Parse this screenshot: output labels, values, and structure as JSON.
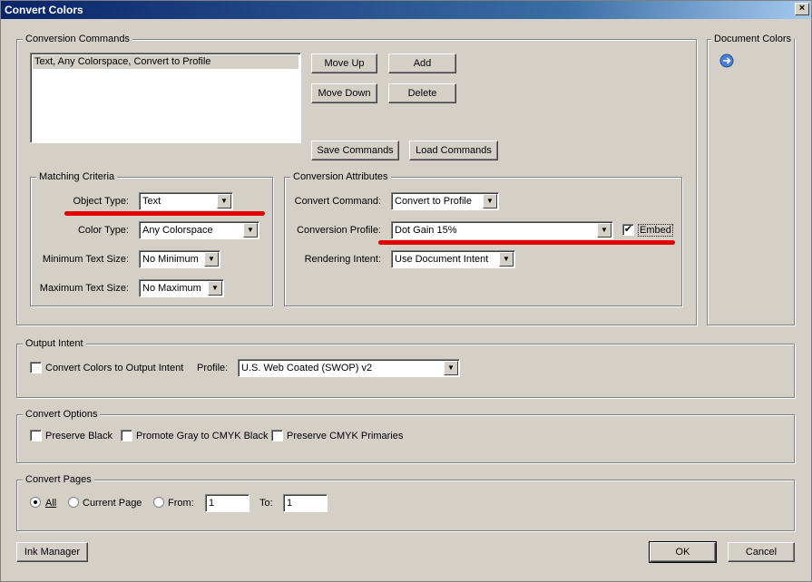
{
  "window": {
    "title": "Convert Colors",
    "close_glyph": "×"
  },
  "conversion_commands": {
    "group_label": "Conversion Commands",
    "list_items": [
      "Text, Any Colorspace, Convert to Profile"
    ],
    "buttons": {
      "move_up": "Move Up",
      "add": "Add",
      "move_down": "Move Down",
      "delete": "Delete",
      "save_commands": "Save Commands",
      "load_commands": "Load Commands"
    }
  },
  "document_colors": {
    "group_label": "Document Colors",
    "icon": "arrow-circle-icon"
  },
  "matching_criteria": {
    "group_label": "Matching Criteria",
    "object_type": {
      "label": "Object Type:",
      "value": "Text"
    },
    "color_type": {
      "label": "Color Type:",
      "value": "Any Colorspace"
    },
    "min_text_size": {
      "label": "Minimum Text Size:",
      "value": "No Minimum"
    },
    "max_text_size": {
      "label": "Maximum Text Size:",
      "value": "No Maximum"
    }
  },
  "conversion_attributes": {
    "group_label": "Conversion Attributes",
    "convert_command": {
      "label": "Convert Command:",
      "value": "Convert to Profile"
    },
    "conversion_profile": {
      "label": "Conversion Profile:",
      "value": "Dot Gain 15%"
    },
    "embed": {
      "label": "Embed",
      "checked": true
    },
    "rendering_intent": {
      "label": "Rendering Intent:",
      "value": "Use Document Intent"
    }
  },
  "output_intent": {
    "group_label": "Output Intent",
    "convert_checkbox_label": "Convert Colors to Output Intent",
    "convert_checked": false,
    "profile_label": "Profile:",
    "profile_value": "U.S. Web Coated (SWOP) v2"
  },
  "convert_options": {
    "group_label": "Convert Options",
    "preserve_black": "Preserve Black",
    "promote_gray": "Promote Gray to CMYK Black",
    "preserve_cmyk": "Preserve CMYK Primaries"
  },
  "convert_pages": {
    "group_label": "Convert Pages",
    "all_label": "All",
    "current_page_label": "Current Page",
    "from_label": "From:",
    "from_value": "1",
    "to_label": "To:",
    "to_value": "1",
    "selected": "all"
  },
  "footer": {
    "ink_manager": "Ink Manager",
    "ok": "OK",
    "cancel": "Cancel"
  },
  "colors": {
    "annotation_red": "#e00000",
    "titlebar": "#0a246a",
    "face": "#d4d0c8"
  }
}
